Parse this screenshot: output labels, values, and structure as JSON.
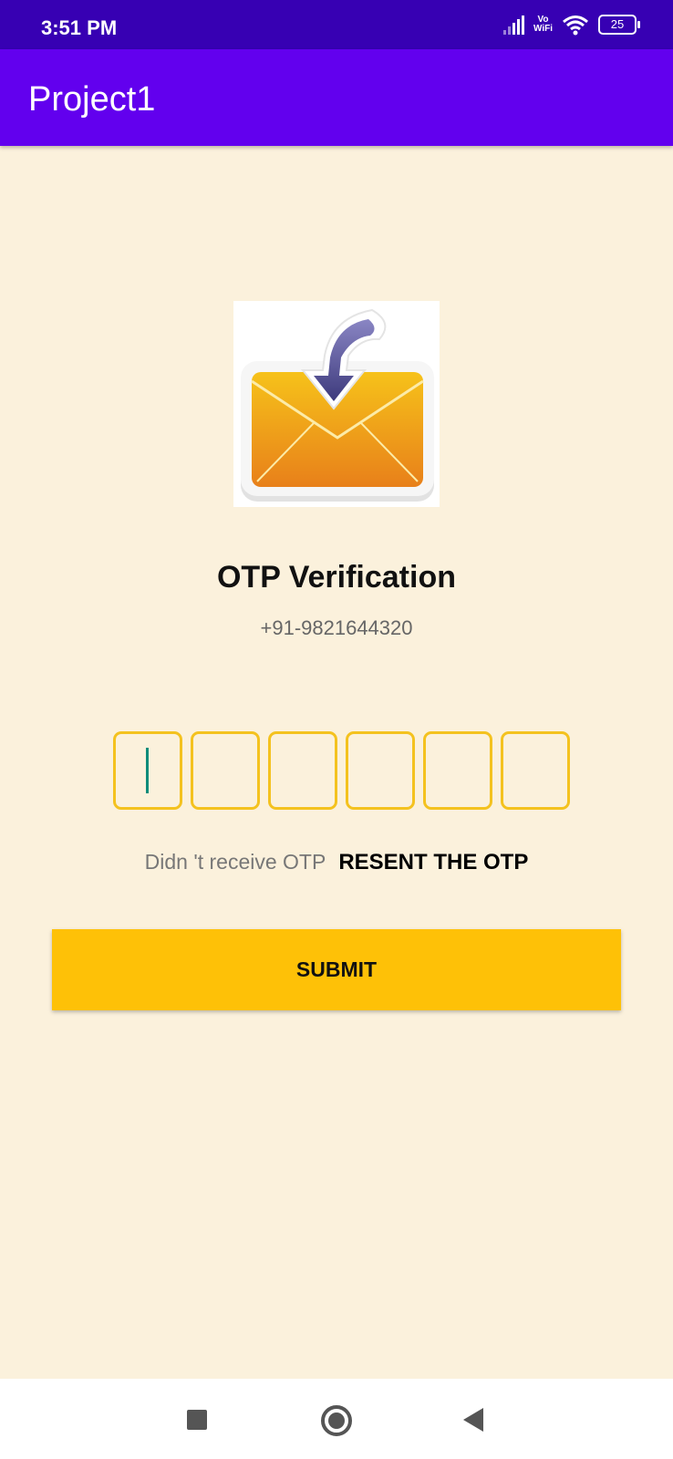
{
  "status_bar": {
    "time": "3:51 PM",
    "vowifi_top": "Vo",
    "vowifi_bottom": "WiFi",
    "battery": "25"
  },
  "app_bar": {
    "title": "Project1"
  },
  "main": {
    "logo_icon": "mail-download-icon",
    "title": "OTP Verification",
    "phone": "+91-9821644320",
    "otp_digits": [
      "",
      "",
      "",
      "",
      "",
      ""
    ],
    "resend_label": "Didn 't receive OTP",
    "resend_link": "RESENT THE OTP",
    "submit_label": "SUBMIT"
  },
  "colors": {
    "status_bar": "#3700B3",
    "app_bar": "#6200EE",
    "background": "#FBF1DC",
    "otp_border": "#F4C21F",
    "submit": "#FEC107"
  },
  "nav_bar": {
    "icons": [
      "recent-apps-icon",
      "home-icon",
      "back-icon"
    ]
  }
}
